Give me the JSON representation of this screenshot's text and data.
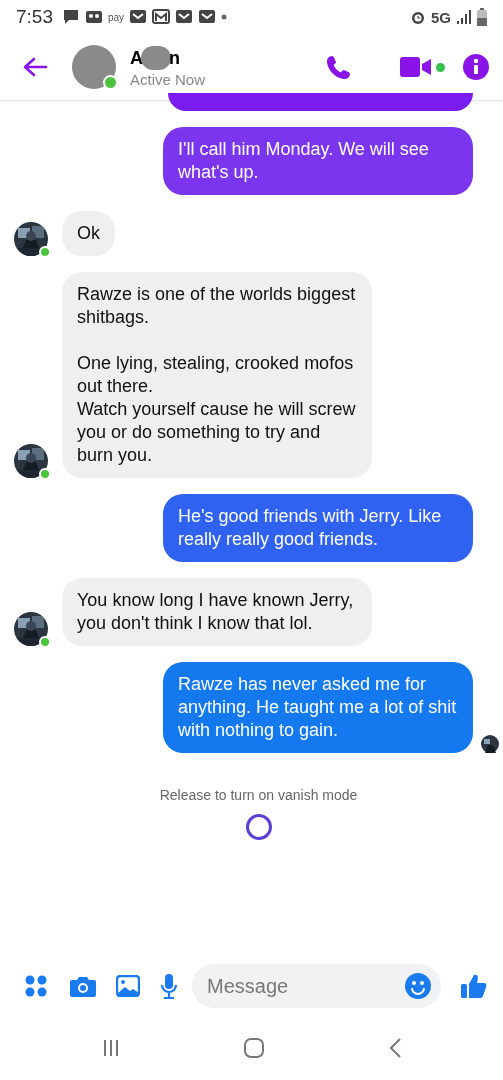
{
  "status_bar": {
    "time": "7:53",
    "pay_label": "pay",
    "network": "5G"
  },
  "header": {
    "name_start": "A",
    "name_end": "n",
    "status": "Active Now",
    "online": true
  },
  "messages": [
    {
      "kind": "outgoing",
      "color": "#7a1cf0",
      "seen": false
    },
    {
      "kind": "outgoing",
      "text": "I'll call him Monday. We will see what's up.",
      "color": "#7b35ef",
      "seen": false
    },
    {
      "kind": "incoming",
      "text": "Ok",
      "online": true
    },
    {
      "kind": "incoming",
      "text": "Rawze is one of the worlds biggest shitbags.\n\nOne lying, stealing, crooked mofos out there.\nWatch yourself cause he will screw you or do something to try and burn you.",
      "online": true
    },
    {
      "kind": "outgoing",
      "text": "He's good friends with Jerry. Like really really good friends.",
      "color": "#2f62f0",
      "seen": false
    },
    {
      "kind": "incoming",
      "text": "You know long I have known Jerry, you don't think I know that lol.",
      "online": true
    },
    {
      "kind": "outgoing",
      "text": "Rawze has never asked me for anything. He taught me a lot of shit with nothing to gain.",
      "color": "#1479ee",
      "seen": true
    }
  ],
  "vanish_hint": "Release to turn on vanish mode",
  "composer": {
    "placeholder": "Message"
  }
}
